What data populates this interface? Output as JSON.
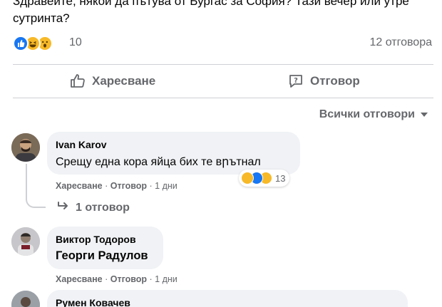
{
  "post": {
    "text": "Здравейте, някой да пътува от Бургас за София? Тази вечер или утре сутринта?",
    "reaction_count": "10",
    "replies_count": "12 отговора",
    "reaction_icons": [
      "like-icon",
      "haha-icon",
      "wow-icon"
    ]
  },
  "actions": {
    "like_label": "Харесване",
    "reply_label": "Отговор"
  },
  "all_replies_label": "Всички отговори",
  "comments": [
    {
      "author": "Ivan Karov",
      "text": "Срещу една кора яйца бих те вրътнал",
      "like": "Харесване",
      "reply": "Отговор",
      "time": "1 дни",
      "reaction_count": "13",
      "reaction_icons": [
        "haha-icon",
        "like-icon",
        "care-icon"
      ],
      "replies_link": "1 отговор"
    },
    {
      "author": "Виктор Тодоров",
      "text": "Георги Радулов",
      "like": "Харесване",
      "reply": "Отговор",
      "time": "1 дни"
    },
    {
      "author": "Румен Ковачев"
    }
  ],
  "colors": {
    "like_blue": "#1877f2",
    "emoji_yellow": "#f7b928",
    "bubble_bg": "#f0f2f5",
    "secondary_text": "#65676b",
    "divider": "#ced0d4"
  }
}
